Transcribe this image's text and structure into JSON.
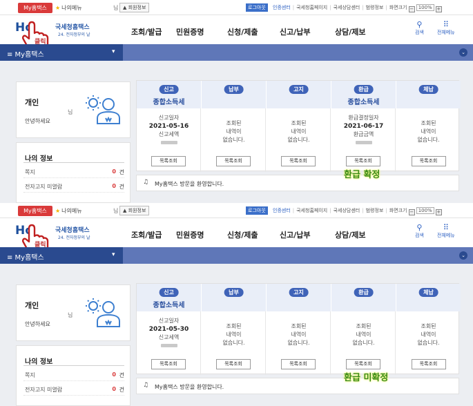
{
  "panels": [
    {
      "utility": {
        "my_tab": "My홈택스",
        "my_menu": "나의메뉴",
        "user_suffix": "님",
        "member_info": "회원정보",
        "logout": "로그아웃",
        "links": [
          "인증센터",
          "국세청홈페이지",
          "국세상담센터",
          "범령정보",
          "화면크기"
        ],
        "zoom": "100%"
      },
      "header": {
        "logo": "Ho",
        "logo_name": "국세청홈택스",
        "logo_tagline": "24. 전자정부의 날",
        "click": "클릭",
        "nav": [
          "조회/발급",
          "민원증명",
          "신청/제출",
          "신고/납부",
          "상담/제보"
        ],
        "search": "검색",
        "all_menu": "전체메뉴"
      },
      "bluebar": {
        "label": "≡  My홈택스"
      },
      "user_card": {
        "title": "개인",
        "suffix": "님",
        "greeting": "안녕하세요"
      },
      "info_card": {
        "title": "나의 정보",
        "rows": [
          {
            "label": "쪽지",
            "count": "0",
            "unit": "건"
          },
          {
            "label": "전자고지 미열람",
            "count": "0",
            "unit": "건"
          }
        ]
      },
      "columns": [
        {
          "pill": "신고",
          "subtitle": "종합소득세",
          "lines": [
            {
              "t": "lbl",
              "v": "신고일자"
            },
            {
              "t": "date",
              "v": "2021-05-16"
            },
            {
              "t": "lbl",
              "v": "신고세액"
            }
          ],
          "masked": true,
          "button": "목록조회"
        },
        {
          "pill": "납부",
          "subtitle": "",
          "lines": [
            {
              "t": "lbl",
              "v": "조회된"
            },
            {
              "t": "lbl",
              "v": "내역이"
            },
            {
              "t": "lbl",
              "v": "없습니다."
            }
          ],
          "masked": false,
          "button": "목록조회"
        },
        {
          "pill": "고지",
          "subtitle": "",
          "lines": [
            {
              "t": "lbl",
              "v": "조회된"
            },
            {
              "t": "lbl",
              "v": "내역이"
            },
            {
              "t": "lbl",
              "v": "없습니다."
            }
          ],
          "masked": false,
          "button": "목록조회"
        },
        {
          "pill": "환급",
          "subtitle": "종합소득세",
          "lines": [
            {
              "t": "lbl",
              "v": "환급결정일자"
            },
            {
              "t": "date",
              "v": "2021-06-17"
            },
            {
              "t": "lbl",
              "v": "환급금액"
            }
          ],
          "masked": true,
          "button": "목록조회"
        },
        {
          "pill": "체납",
          "subtitle": "",
          "lines": [
            {
              "t": "lbl",
              "v": "조회된"
            },
            {
              "t": "lbl",
              "v": "내역이"
            },
            {
              "t": "lbl",
              "v": "없습니다."
            }
          ],
          "masked": false,
          "button": "목록조회"
        }
      ],
      "notice": "My홈택스 방문을 환영합니다.",
      "annotation": "환급 확정"
    },
    {
      "utility": {
        "my_tab": "My홈택스",
        "my_menu": "나의메뉴",
        "user_suffix": "님",
        "member_info": "회원정보",
        "logout": "로그아웃",
        "links": [
          "인증센터",
          "국세청홈페이지",
          "국세상담센터",
          "범령정보",
          "화면크기"
        ],
        "zoom": "100%"
      },
      "header": {
        "logo": "Ho",
        "logo_name": "국세청홈택스",
        "logo_tagline": "24. 전자정부의 날",
        "click": "클릭",
        "nav": [
          "조회/발급",
          "민원증명",
          "신청/제출",
          "신고/납부",
          "상담/제보"
        ],
        "search": "검색",
        "all_menu": "전체메뉴"
      },
      "bluebar": {
        "label": "≡  My홈택스"
      },
      "user_card": {
        "title": "개인",
        "suffix": "님",
        "greeting": "안녕하세요"
      },
      "info_card": {
        "title": "나의 정보",
        "rows": [
          {
            "label": "쪽지",
            "count": "0",
            "unit": "건"
          },
          {
            "label": "전자고지 미열람",
            "count": "0",
            "unit": "건"
          }
        ]
      },
      "columns": [
        {
          "pill": "신고",
          "subtitle": "종합소득세",
          "lines": [
            {
              "t": "lbl",
              "v": "신고일자"
            },
            {
              "t": "date",
              "v": "2021-05-30"
            },
            {
              "t": "lbl",
              "v": "신고세액"
            }
          ],
          "masked": true,
          "button": "목록조회"
        },
        {
          "pill": "납부",
          "subtitle": "",
          "lines": [
            {
              "t": "lbl",
              "v": "조회된"
            },
            {
              "t": "lbl",
              "v": "내역이"
            },
            {
              "t": "lbl",
              "v": "없습니다."
            }
          ],
          "masked": false,
          "button": "목록조회"
        },
        {
          "pill": "고지",
          "subtitle": "",
          "lines": [
            {
              "t": "lbl",
              "v": "조회된"
            },
            {
              "t": "lbl",
              "v": "내역이"
            },
            {
              "t": "lbl",
              "v": "없습니다."
            }
          ],
          "masked": false,
          "button": "목록조회"
        },
        {
          "pill": "환급",
          "subtitle": "",
          "lines": [
            {
              "t": "lbl",
              "v": "조회된"
            },
            {
              "t": "lbl",
              "v": "내역이"
            },
            {
              "t": "lbl",
              "v": "없습니다."
            }
          ],
          "masked": false,
          "button": "목록조회"
        },
        {
          "pill": "체납",
          "subtitle": "",
          "lines": [
            {
              "t": "lbl",
              "v": "조회된"
            },
            {
              "t": "lbl",
              "v": "내역이"
            },
            {
              "t": "lbl",
              "v": "없습니다."
            }
          ],
          "masked": false,
          "button": "목록조회"
        }
      ],
      "notice": "My홈택스 방문을 환영합니다.",
      "annotation": "환급 미확정"
    }
  ]
}
